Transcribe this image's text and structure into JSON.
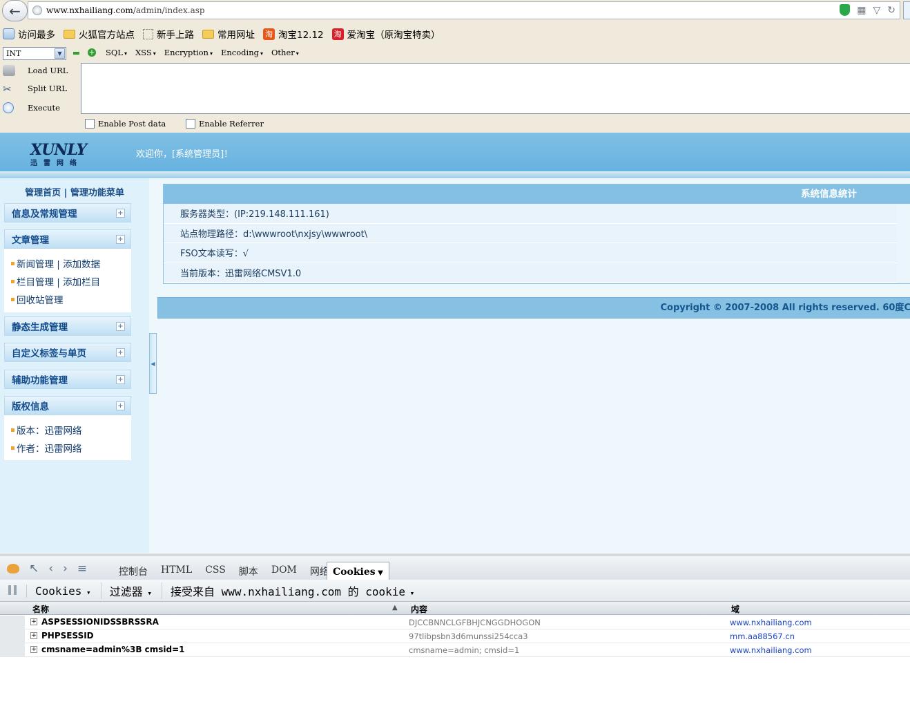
{
  "browser": {
    "url_domain": "www.nxhailiang.com",
    "url_path": "/admin/index.asp"
  },
  "bookmarks": [
    {
      "label": "访问最多",
      "icon": "most-visited-icon"
    },
    {
      "label": "火狐官方站点",
      "icon": "folder-icon"
    },
    {
      "label": "新手上路",
      "icon": "blank-page-icon"
    },
    {
      "label": "常用网址",
      "icon": "folder-icon"
    },
    {
      "label": "淘宝12.12",
      "icon": "taobao-icon"
    },
    {
      "label": "爱淘宝（原淘宝特卖）",
      "icon": "taobao-icon"
    }
  ],
  "hackbar": {
    "select_value": "INT",
    "menus": [
      "SQL",
      "XSS",
      "Encryption",
      "Encoding",
      "Other"
    ],
    "load_url": "Load URL",
    "split_url": "Split URL",
    "execute": "Execute",
    "enable_post": "Enable Post data",
    "enable_referrer": "Enable Referrer"
  },
  "site": {
    "logo_text": "XUNLY",
    "logo_sub": "迅雷网络",
    "welcome": "欢迎你，[系统管理员]！"
  },
  "sidebar": {
    "title": "管理首页 | 管理功能菜单",
    "sections": [
      {
        "title": "信息及常规管理",
        "items": []
      },
      {
        "title": "文章管理",
        "items": [
          "新闻管理 | 添加数据",
          "栏目管理 | 添加栏目",
          "回收站管理"
        ]
      },
      {
        "title": "静态生成管理",
        "items": []
      },
      {
        "title": "自定义标签与单页",
        "items": []
      },
      {
        "title": "辅助功能管理",
        "items": []
      },
      {
        "title": "版权信息",
        "items": [
          "版本：迅雷网络",
          "作者：迅雷网络"
        ]
      }
    ]
  },
  "main": {
    "panel_title": "系统信息统计",
    "rows": [
      "服务器类型：(IP:219.148.111.161)",
      "站点物理路径：d:\\wwwroot\\nxjsy\\wwwroot\\",
      "FSO文本读写：√",
      "当前版本：迅雷网络CMSV1.0"
    ],
    "copyright": "Copyright © 2007-2008 All rights reserved. 60度C"
  },
  "firebug": {
    "tabs": [
      "控制台",
      "HTML",
      "CSS",
      "脚本",
      "DOM",
      "网络"
    ],
    "active_tab": "Cookies",
    "sub_cookies": "Cookies",
    "sub_filter": "过滤器",
    "sub_accept": "接受来自 www.nxhailiang.com 的 cookie",
    "columns": [
      "名称",
      "内容",
      "域"
    ],
    "rows": [
      {
        "name": "ASPSESSIONIDSSBRSSRA",
        "value": "DJCCBNNCLGFBHJCNGGDHOGON",
        "domain": "www.nxhailiang.com"
      },
      {
        "name": "PHPSESSID",
        "value": "97tlibpsbn3d6munssi254cca3",
        "domain": "mm.aa88567.cn"
      },
      {
        "name": "cmsname=admin%3B cmsid=1",
        "value": "cmsname=admin; cmsid=1",
        "domain": "www.nxhailiang.com"
      }
    ]
  }
}
